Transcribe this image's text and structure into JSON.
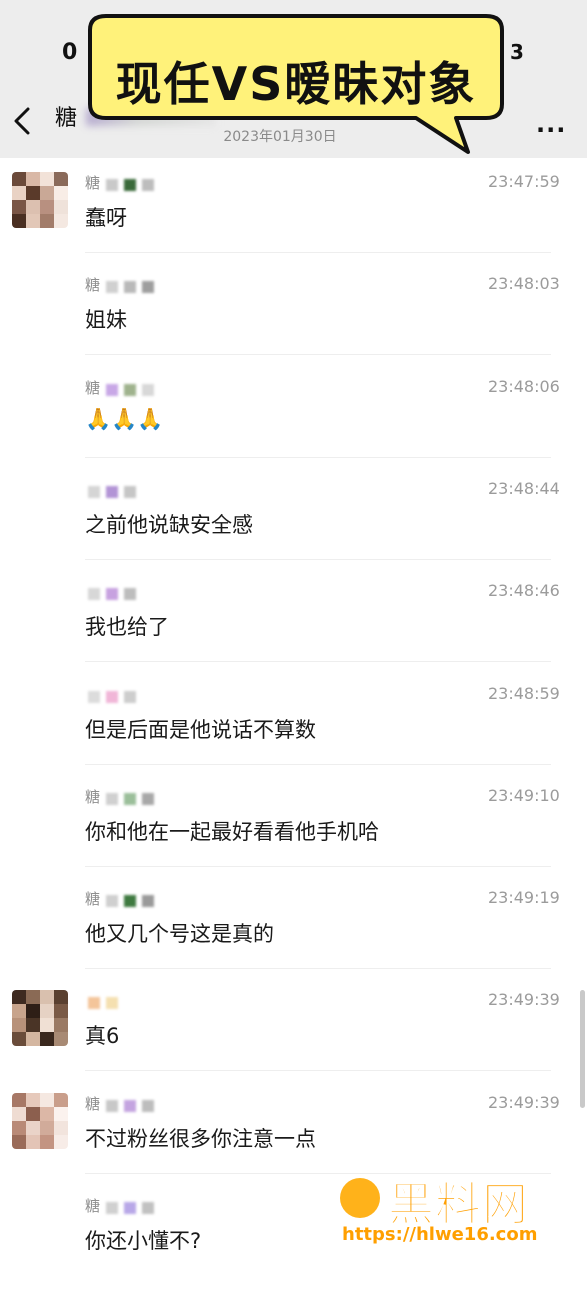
{
  "status_bar": {
    "time_partial": "0",
    "battery_partial": "3"
  },
  "header": {
    "back_icon": "chevron-left-icon",
    "title_partial": "糖",
    "date": "2023年01月30日",
    "more_icon": "more-dots-icon",
    "more_label": "..."
  },
  "banner": {
    "text": "现任VS暧昧对象",
    "color": "#fff27a"
  },
  "messages": [
    {
      "sender": "糖",
      "time": "23:47:59",
      "text": "蠢呀",
      "avatar": true
    },
    {
      "sender": "糖",
      "time": "23:48:03",
      "text": "姐妹",
      "avatar": false
    },
    {
      "sender": "糖",
      "time": "23:48:06",
      "text": "🙏🙏🙏",
      "avatar": false
    },
    {
      "sender": "",
      "time": "23:48:44",
      "text": "之前他说缺安全感",
      "avatar": false
    },
    {
      "sender": "",
      "time": "23:48:46",
      "text": "我也给了",
      "avatar": false
    },
    {
      "sender": "",
      "time": "23:48:59",
      "text": "但是后面是他说话不算数",
      "avatar": false
    },
    {
      "sender": "糖",
      "time": "23:49:10",
      "text": "你和他在一起最好看看他手机哈",
      "avatar": false
    },
    {
      "sender": "糖",
      "time": "23:49:19",
      "text": "他又几个号这是真的",
      "avatar": false
    },
    {
      "sender": "",
      "time": "23:49:39",
      "text": "真6",
      "avatar": true
    },
    {
      "sender": "糖",
      "time": "23:49:39",
      "text": "不过粉丝很多你注意一点",
      "avatar": true
    },
    {
      "sender": "糖",
      "time": "",
      "text": "你还小懂不?",
      "avatar": false
    }
  ],
  "watermark": {
    "title": "黑料网",
    "url": "https://hlwe16.com",
    "color": "#ff9f00"
  }
}
